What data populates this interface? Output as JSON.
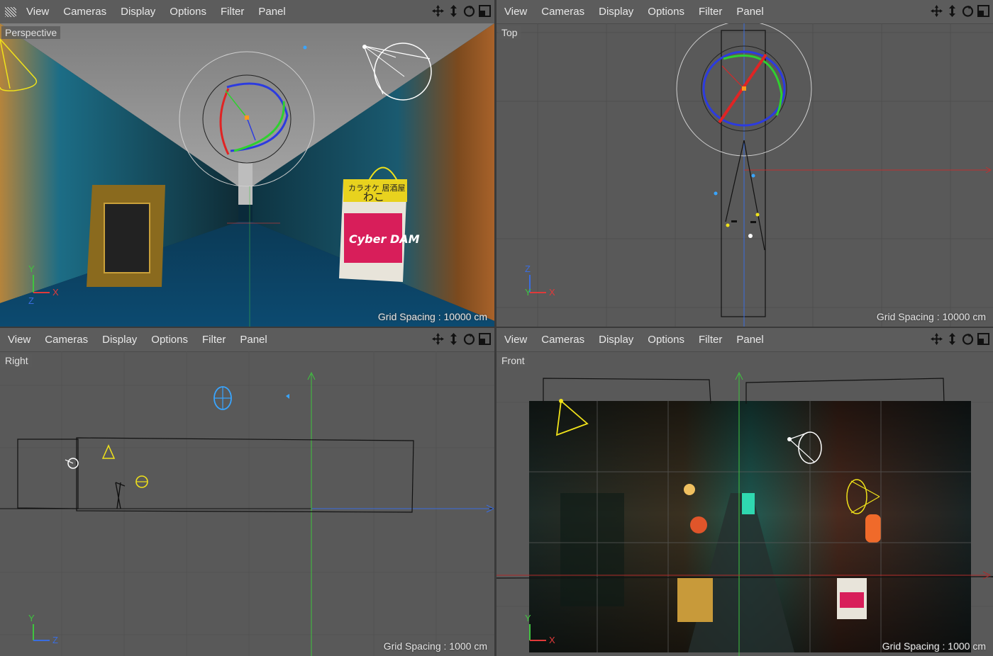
{
  "menu": [
    "View",
    "Cameras",
    "Display",
    "Options",
    "Filter",
    "Panel"
  ],
  "nav_icons": [
    "move-icon",
    "zoom-icon",
    "rotate-icon",
    "maximize-icon"
  ],
  "viewports": {
    "perspective": {
      "label": "Perspective",
      "grid_spacing": "Grid Spacing : 10000 cm"
    },
    "top": {
      "label": "Top",
      "grid_spacing": "Grid Spacing : 10000 cm"
    },
    "right": {
      "label": "Right",
      "grid_spacing": "Grid Spacing : 1000 cm"
    },
    "front": {
      "label": "Front",
      "grid_spacing": "Grid Spacing : 1000 cm"
    }
  },
  "axes": {
    "perspective": [
      "Y",
      "X",
      "Z"
    ],
    "top": [
      "Z",
      "Y",
      "X"
    ],
    "right": [
      "Y",
      "Z"
    ],
    "front": [
      "Y",
      "X"
    ]
  },
  "colors": {
    "x_axis": "#e03a3a",
    "y_axis": "#3fc43f",
    "z_axis": "#3a6de0",
    "viewport_bg": "#595959",
    "grid": "#4f4f4f",
    "light": "#f0e21a"
  },
  "scene_text": {
    "sign_top": "カラオケ 居酒屋",
    "sign_name": "わこ",
    "sign_brand": "Cyber DAM"
  }
}
